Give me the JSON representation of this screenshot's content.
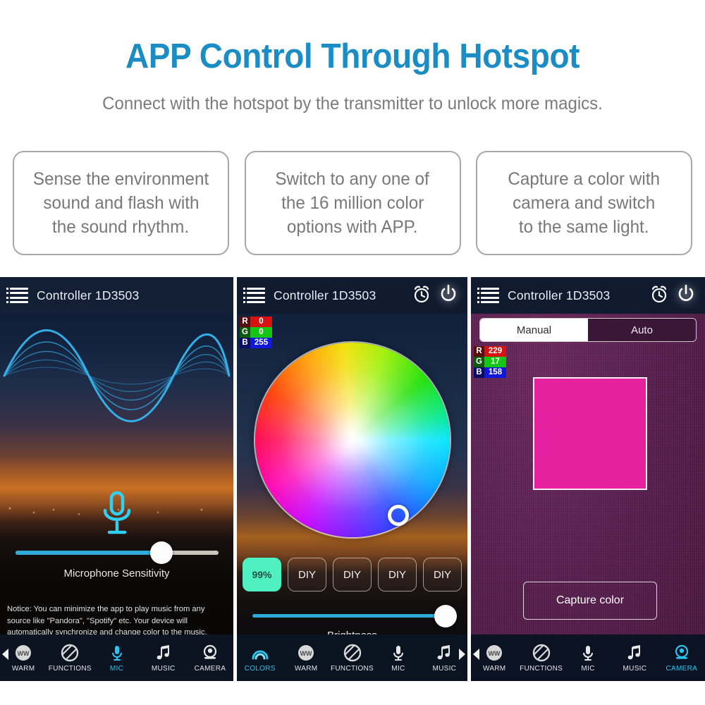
{
  "header": {
    "title": "APP Control Through Hotspot",
    "subtitle": "Connect with the hotspot by the transmitter to unlock more magics.",
    "title_color": "#1b8cc4",
    "subtitle_color": "#7b7b7b"
  },
  "features": [
    {
      "name": "sound-reactive",
      "lines": [
        "Sense the environment",
        "sound and flash with",
        "the sound rhythm."
      ]
    },
    {
      "name": "color-options",
      "lines": [
        "Switch to any one of",
        "the 16 million color",
        "options with APP."
      ]
    },
    {
      "name": "camera-capture",
      "lines": [
        "Capture a color with",
        "camera and switch",
        "to the same light."
      ]
    }
  ],
  "panels": {
    "mic": {
      "app_title": "Controller 1D3503",
      "menu_icon": "list-icon",
      "slider_label": "Microphone Sensitivity",
      "slider_value": 72,
      "notice": "Notice: You can minimize the app to play music from any source like \"Pandora\", \"Spotify\" etc. Your device will automatically synchronize and change color to the music.",
      "nav": [
        {
          "label": "WARM",
          "icon": "warm-ww-icon",
          "active": false
        },
        {
          "label": "FUNCTIONS",
          "icon": "functions-icon",
          "active": false
        },
        {
          "label": "MIC",
          "icon": "microphone-icon",
          "active": true
        },
        {
          "label": "MUSIC",
          "icon": "music-note-icon",
          "active": false
        },
        {
          "label": "CAMERA",
          "icon": "camera-icon",
          "active": false
        }
      ],
      "nav_arrow": "left-arrow-icon"
    },
    "colors": {
      "app_title": "Controller 1D3503",
      "menu_icon": "list-icon",
      "alarm_icon": "alarm-clock-icon",
      "power_icon": "power-icon",
      "rgb": {
        "r_key": "R",
        "r": "0",
        "g_key": "G",
        "g": "0",
        "b_key": "B",
        "b": "255"
      },
      "preset_buttons": [
        {
          "label": "99%",
          "filled": true
        },
        {
          "label": "DIY",
          "filled": false
        },
        {
          "label": "DIY",
          "filled": false
        },
        {
          "label": "DIY",
          "filled": false
        },
        {
          "label": "DIY",
          "filled": false
        }
      ],
      "slider_label": "Brightness",
      "slider_value": 95,
      "nav": [
        {
          "label": "COLORS",
          "icon": "rainbow-icon",
          "active": true
        },
        {
          "label": "WARM",
          "icon": "warm-ww-icon",
          "active": false
        },
        {
          "label": "FUNCTIONS",
          "icon": "functions-icon",
          "active": false
        },
        {
          "label": "MIC",
          "icon": "microphone-icon",
          "active": false
        },
        {
          "label": "MUSIC",
          "icon": "music-note-icon",
          "active": false
        }
      ],
      "nav_arrow": "right-arrow-icon"
    },
    "camera": {
      "app_title": "Controller 1D3503",
      "menu_icon": "list-icon",
      "alarm_icon": "alarm-clock-icon",
      "power_icon": "power-icon",
      "mode_tabs": [
        {
          "label": "Manual",
          "selected": true
        },
        {
          "label": "Auto",
          "selected": false
        }
      ],
      "rgb": {
        "r_key": "R",
        "r": "229",
        "g_key": "G",
        "g": "17",
        "b_key": "B",
        "b": "158"
      },
      "swatch_color": "#e5219f",
      "capture_label": "Capture color",
      "nav": [
        {
          "label": "WARM",
          "icon": "warm-ww-icon",
          "active": false
        },
        {
          "label": "FUNCTIONS",
          "icon": "functions-icon",
          "active": false
        },
        {
          "label": "MIC",
          "icon": "microphone-icon",
          "active": false
        },
        {
          "label": "MUSIC",
          "icon": "music-note-icon",
          "active": false
        },
        {
          "label": "CAMERA",
          "icon": "camera-icon",
          "active": true
        }
      ],
      "nav_arrow": "left-arrow-icon"
    }
  }
}
